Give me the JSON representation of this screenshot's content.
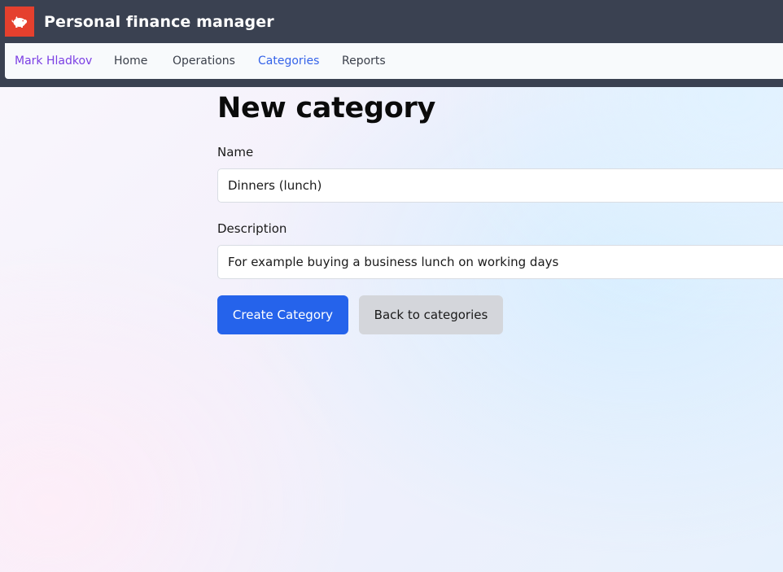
{
  "app": {
    "title": "Personal finance manager",
    "logo_icon": "piggy-bank-icon",
    "accent_color": "#e5402e"
  },
  "nav": {
    "user": "Mark Hladkov",
    "items": [
      {
        "label": "Home"
      },
      {
        "label": "Operations"
      },
      {
        "label": "Categories",
        "active": true
      },
      {
        "label": "Reports"
      }
    ]
  },
  "form": {
    "title": "New category",
    "name_label": "Name",
    "name_value": "Dinners (lunch)",
    "description_label": "Description",
    "description_value": "For example buying a business lunch on working days",
    "create_button": "Create Category",
    "back_button": "Back to categories"
  },
  "colors": {
    "topbar": "#3a4151",
    "primary_button": "#2563eb",
    "secondary_button": "#d4d6db",
    "user_link": "#7b3fe4",
    "active_link": "#3563e9"
  }
}
